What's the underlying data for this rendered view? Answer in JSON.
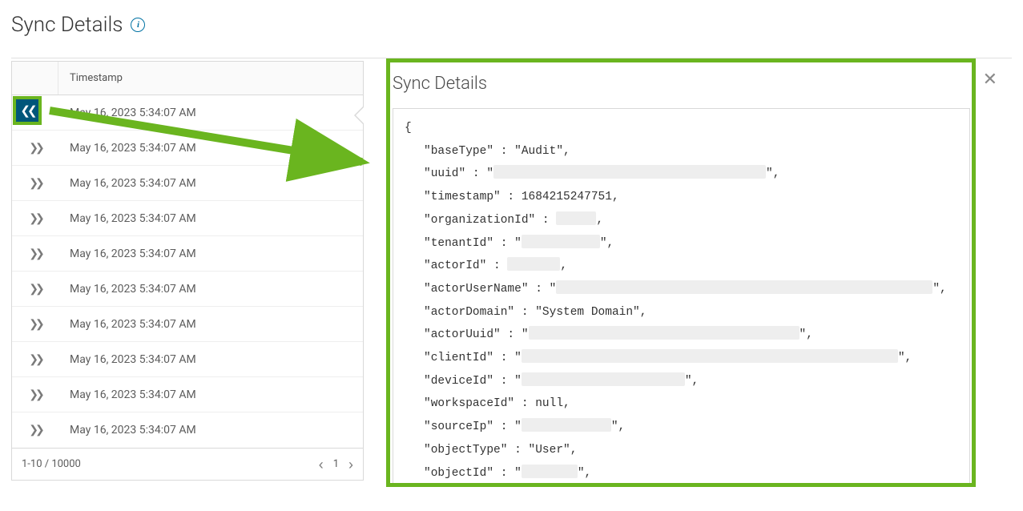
{
  "page": {
    "title": "Sync Details"
  },
  "table": {
    "header": "Timestamp",
    "rows": [
      {
        "timestamp": "May 16, 2023 5:34:07 AM"
      },
      {
        "timestamp": "May 16, 2023 5:34:07 AM"
      },
      {
        "timestamp": "May 16, 2023 5:34:07 AM"
      },
      {
        "timestamp": "May 16, 2023 5:34:07 AM"
      },
      {
        "timestamp": "May 16, 2023 5:34:07 AM"
      },
      {
        "timestamp": "May 16, 2023 5:34:07 AM"
      },
      {
        "timestamp": "May 16, 2023 5:34:07 AM"
      },
      {
        "timestamp": "May 16, 2023 5:34:07 AM"
      },
      {
        "timestamp": "May 16, 2023 5:34:07 AM"
      },
      {
        "timestamp": "May 16, 2023 5:34:07 AM"
      }
    ],
    "pagination": {
      "range": "1-10 / 10000",
      "page": "1"
    }
  },
  "detail": {
    "title": "Sync Details",
    "json": {
      "baseType": "Audit",
      "uuid_redacted_width": 340,
      "timestamp": "1684215247751",
      "organizationId_redacted_width": 50,
      "tenantId_redacted_width": 98,
      "actorId_redacted_width": 66,
      "actorUserName_redacted_width": 470,
      "actorDomain": "System Domain",
      "actorUuid_redacted_width": 338,
      "clientId_redacted_width": 470,
      "deviceId_redacted_width": 204,
      "workspaceId": "null",
      "sourceIp_redacted_width": 112,
      "objectType": "User",
      "objectId_redacted_width": 70
    }
  }
}
